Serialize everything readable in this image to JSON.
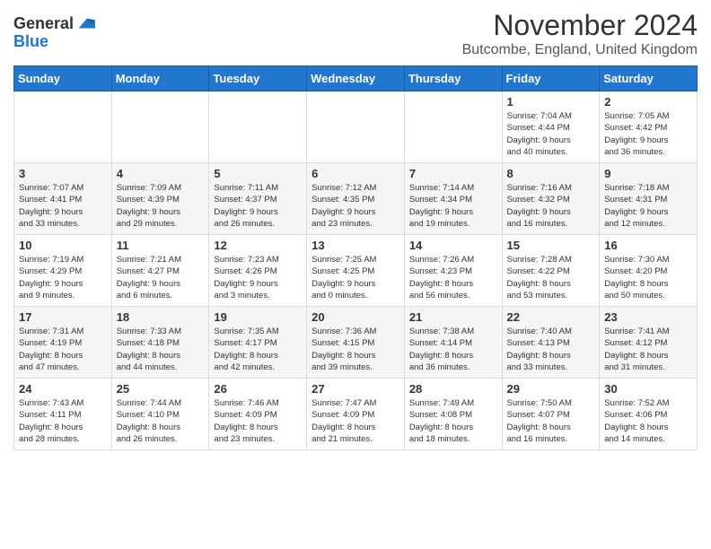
{
  "logo": {
    "general": "General",
    "blue": "Blue"
  },
  "title": "November 2024",
  "location": "Butcombe, England, United Kingdom",
  "weekdays": [
    "Sunday",
    "Monday",
    "Tuesday",
    "Wednesday",
    "Thursday",
    "Friday",
    "Saturday"
  ],
  "weeks": [
    [
      {
        "day": "",
        "info": ""
      },
      {
        "day": "",
        "info": ""
      },
      {
        "day": "",
        "info": ""
      },
      {
        "day": "",
        "info": ""
      },
      {
        "day": "",
        "info": ""
      },
      {
        "day": "1",
        "info": "Sunrise: 7:04 AM\nSunset: 4:44 PM\nDaylight: 9 hours\nand 40 minutes."
      },
      {
        "day": "2",
        "info": "Sunrise: 7:05 AM\nSunset: 4:42 PM\nDaylight: 9 hours\nand 36 minutes."
      }
    ],
    [
      {
        "day": "3",
        "info": "Sunrise: 7:07 AM\nSunset: 4:41 PM\nDaylight: 9 hours\nand 33 minutes."
      },
      {
        "day": "4",
        "info": "Sunrise: 7:09 AM\nSunset: 4:39 PM\nDaylight: 9 hours\nand 29 minutes."
      },
      {
        "day": "5",
        "info": "Sunrise: 7:11 AM\nSunset: 4:37 PM\nDaylight: 9 hours\nand 26 minutes."
      },
      {
        "day": "6",
        "info": "Sunrise: 7:12 AM\nSunset: 4:35 PM\nDaylight: 9 hours\nand 23 minutes."
      },
      {
        "day": "7",
        "info": "Sunrise: 7:14 AM\nSunset: 4:34 PM\nDaylight: 9 hours\nand 19 minutes."
      },
      {
        "day": "8",
        "info": "Sunrise: 7:16 AM\nSunset: 4:32 PM\nDaylight: 9 hours\nand 16 minutes."
      },
      {
        "day": "9",
        "info": "Sunrise: 7:18 AM\nSunset: 4:31 PM\nDaylight: 9 hours\nand 12 minutes."
      }
    ],
    [
      {
        "day": "10",
        "info": "Sunrise: 7:19 AM\nSunset: 4:29 PM\nDaylight: 9 hours\nand 9 minutes."
      },
      {
        "day": "11",
        "info": "Sunrise: 7:21 AM\nSunset: 4:27 PM\nDaylight: 9 hours\nand 6 minutes."
      },
      {
        "day": "12",
        "info": "Sunrise: 7:23 AM\nSunset: 4:26 PM\nDaylight: 9 hours\nand 3 minutes."
      },
      {
        "day": "13",
        "info": "Sunrise: 7:25 AM\nSunset: 4:25 PM\nDaylight: 9 hours\nand 0 minutes."
      },
      {
        "day": "14",
        "info": "Sunrise: 7:26 AM\nSunset: 4:23 PM\nDaylight: 8 hours\nand 56 minutes."
      },
      {
        "day": "15",
        "info": "Sunrise: 7:28 AM\nSunset: 4:22 PM\nDaylight: 8 hours\nand 53 minutes."
      },
      {
        "day": "16",
        "info": "Sunrise: 7:30 AM\nSunset: 4:20 PM\nDaylight: 8 hours\nand 50 minutes."
      }
    ],
    [
      {
        "day": "17",
        "info": "Sunrise: 7:31 AM\nSunset: 4:19 PM\nDaylight: 8 hours\nand 47 minutes."
      },
      {
        "day": "18",
        "info": "Sunrise: 7:33 AM\nSunset: 4:18 PM\nDaylight: 8 hours\nand 44 minutes."
      },
      {
        "day": "19",
        "info": "Sunrise: 7:35 AM\nSunset: 4:17 PM\nDaylight: 8 hours\nand 42 minutes."
      },
      {
        "day": "20",
        "info": "Sunrise: 7:36 AM\nSunset: 4:15 PM\nDaylight: 8 hours\nand 39 minutes."
      },
      {
        "day": "21",
        "info": "Sunrise: 7:38 AM\nSunset: 4:14 PM\nDaylight: 8 hours\nand 36 minutes."
      },
      {
        "day": "22",
        "info": "Sunrise: 7:40 AM\nSunset: 4:13 PM\nDaylight: 8 hours\nand 33 minutes."
      },
      {
        "day": "23",
        "info": "Sunrise: 7:41 AM\nSunset: 4:12 PM\nDaylight: 8 hours\nand 31 minutes."
      }
    ],
    [
      {
        "day": "24",
        "info": "Sunrise: 7:43 AM\nSunset: 4:11 PM\nDaylight: 8 hours\nand 28 minutes."
      },
      {
        "day": "25",
        "info": "Sunrise: 7:44 AM\nSunset: 4:10 PM\nDaylight: 8 hours\nand 26 minutes."
      },
      {
        "day": "26",
        "info": "Sunrise: 7:46 AM\nSunset: 4:09 PM\nDaylight: 8 hours\nand 23 minutes."
      },
      {
        "day": "27",
        "info": "Sunrise: 7:47 AM\nSunset: 4:09 PM\nDaylight: 8 hours\nand 21 minutes."
      },
      {
        "day": "28",
        "info": "Sunrise: 7:49 AM\nSunset: 4:08 PM\nDaylight: 8 hours\nand 18 minutes."
      },
      {
        "day": "29",
        "info": "Sunrise: 7:50 AM\nSunset: 4:07 PM\nDaylight: 8 hours\nand 16 minutes."
      },
      {
        "day": "30",
        "info": "Sunrise: 7:52 AM\nSunset: 4:06 PM\nDaylight: 8 hours\nand 14 minutes."
      }
    ]
  ]
}
